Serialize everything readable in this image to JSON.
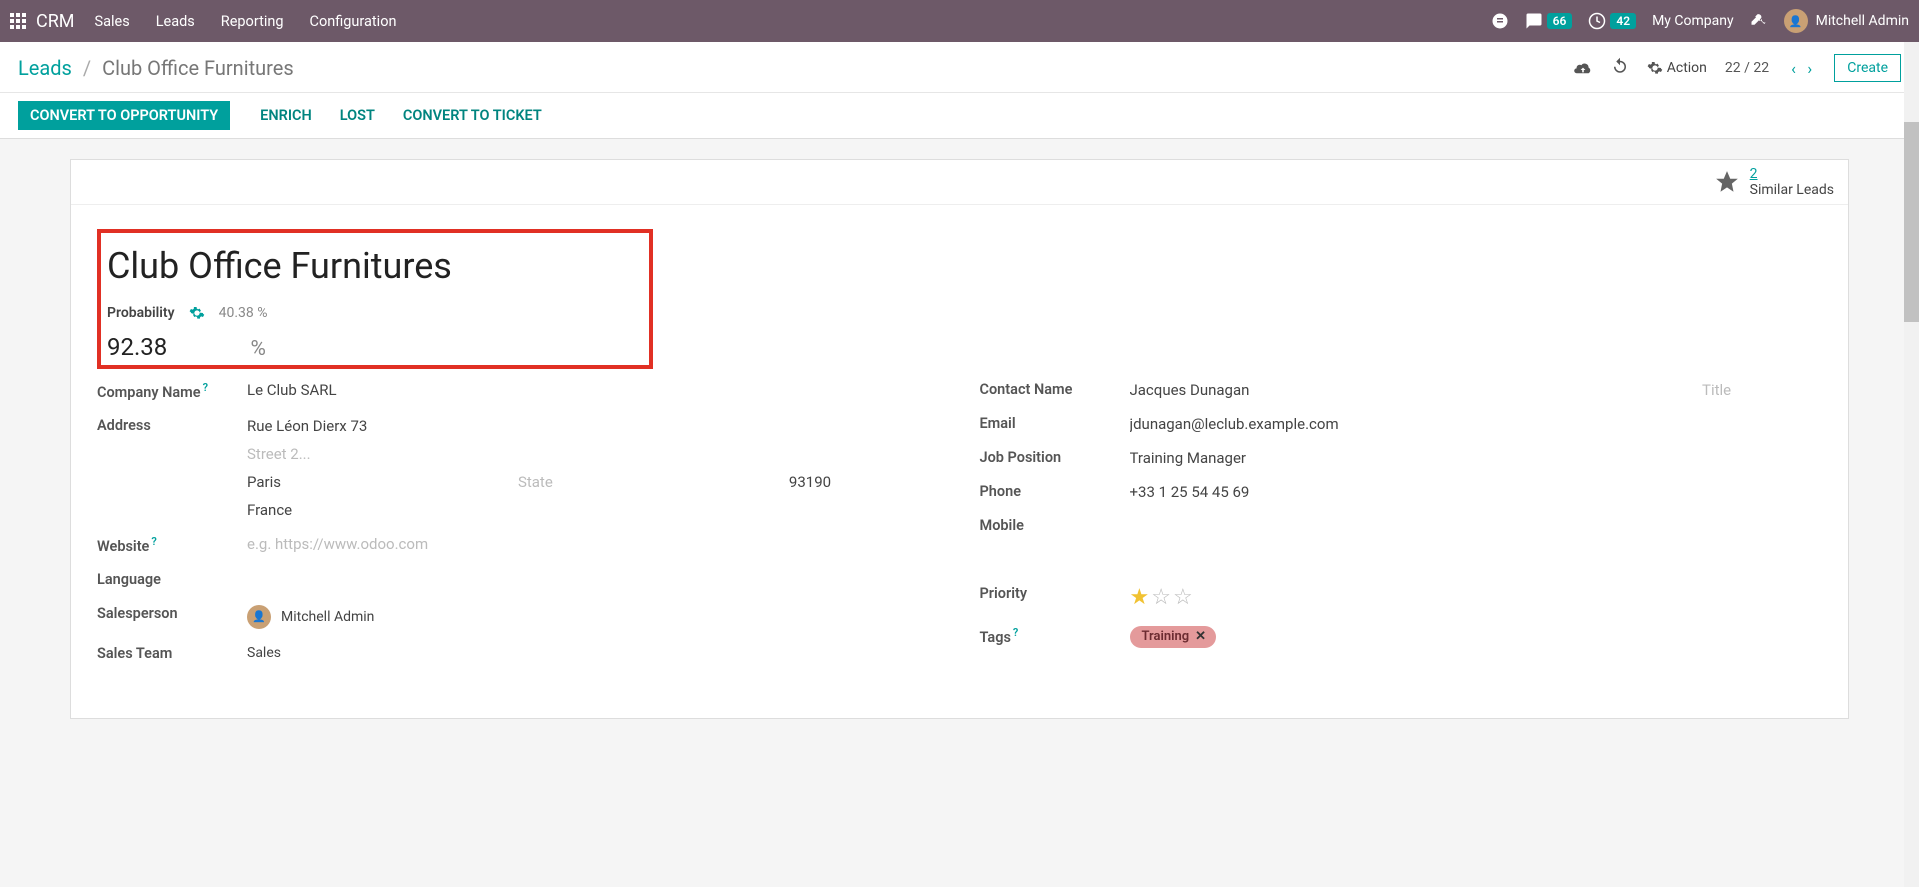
{
  "nav": {
    "brand": "CRM",
    "menu": [
      "Sales",
      "Leads",
      "Reporting",
      "Configuration"
    ],
    "badges": {
      "chat": "66",
      "activities": "42"
    },
    "company": "My Company",
    "user": "Mitchell Admin"
  },
  "cp": {
    "crumb_root": "Leads",
    "crumb_leaf": "Club Office Furnitures",
    "action_label": "Action",
    "pager": "22 / 22",
    "create": "Create"
  },
  "status": {
    "convert": "CONVERT TO OPPORTUNITY",
    "enrich": "ENRICH",
    "lost": "LOST",
    "ticket": "CONVERT TO TICKET"
  },
  "similar": {
    "count": "2",
    "label": "Similar Leads"
  },
  "lead": {
    "title": "Club Office Furnitures",
    "probability_label": "Probability",
    "auto_prob": "40.38 %",
    "probability_value": "92.38",
    "company_label": "Company Name",
    "company": "Le Club SARL",
    "address_label": "Address",
    "street": "Rue Léon Dierx 73",
    "street2_ph": "Street 2...",
    "city": "Paris",
    "state_ph": "State",
    "zip": "93190",
    "country": "France",
    "website_label": "Website",
    "website_ph": "e.g. https://www.odoo.com",
    "language_label": "Language",
    "salesperson_label": "Salesperson",
    "salesperson": "Mitchell Admin",
    "salesteam_label": "Sales Team",
    "salesteam": "Sales",
    "contact_label": "Contact Name",
    "contact": "Jacques Dunagan",
    "contact_title_ph": "Title",
    "email_label": "Email",
    "email": "jdunagan@leclub.example.com",
    "position_label": "Job Position",
    "position": "Training Manager",
    "phone_label": "Phone",
    "phone": "+33 1 25 54 45 69",
    "mobile_label": "Mobile",
    "priority_label": "Priority",
    "tags_label": "Tags",
    "tag": "Training"
  }
}
